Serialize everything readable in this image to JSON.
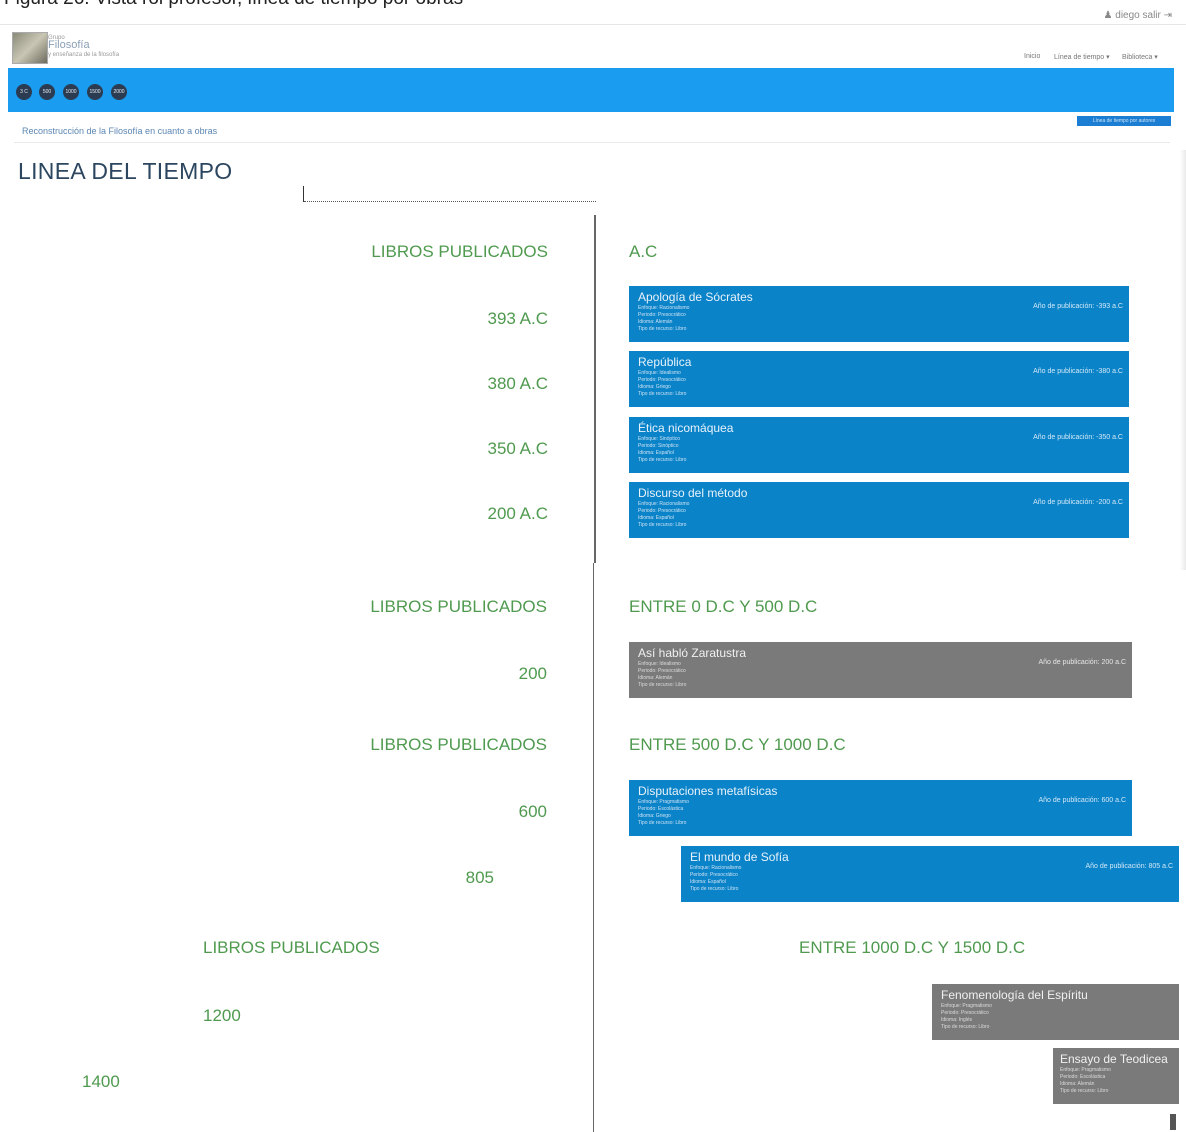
{
  "caption": "Figura 26: Vista rol profesor, línea de tiempo por obras",
  "user": {
    "label": "♟ diego  salir ⇥"
  },
  "brand": {
    "small": "Grupo",
    "name": "Filosofía",
    "sub": "y enseñanza de la filosofía"
  },
  "nav": {
    "inicio": "Inicio",
    "linea": "Línea de tiempo ▾",
    "biblioteca": "Biblioteca ▾"
  },
  "eras": [
    "3 C",
    "500",
    "1000",
    "1500",
    "2000"
  ],
  "breadcrumb": "Reconstrucción de la Filosofía en cuanto a obras",
  "top_button": "Línea de tiempo por autores",
  "page_title": "LINEA DEL TIEMPO",
  "sections": [
    {
      "left_label": "LIBROS PUBLICADOS",
      "right_label": "A.C",
      "years": [
        "393 A.C",
        "380 A.C",
        "350 A.C",
        "200 A.C"
      ],
      "cards": [
        {
          "title": "Apología de Sócrates",
          "meta": [
            "Enfoque: Racionalismo",
            "Periodo: Presocrático",
            "Idioma: Alemán",
            "Tipo de recurso: Libro"
          ],
          "year": "Año de publicación: -393 a.C"
        },
        {
          "title": "República",
          "meta": [
            "Enfoque: Idealismo",
            "Periodo: Presocrático",
            "Idioma: Griego",
            "Tipo de recurso: Libro"
          ],
          "year": "Año de publicación: -380 a.C"
        },
        {
          "title": "Ética nicomáquea",
          "meta": [
            "Enfoque: Sinóptico",
            "Periodo: Sinóptico",
            "Idioma: Español",
            "Tipo de recurso: Libro"
          ],
          "year": "Año de publicación: -350 a.C"
        },
        {
          "title": "Discurso del método",
          "meta": [
            "Enfoque: Racionalismo",
            "Periodo: Presocrático",
            "Idioma: Español",
            "Tipo de recurso: Libro"
          ],
          "year": "Año de publicación: -200 a.C"
        }
      ]
    },
    {
      "left_label": "LIBROS PUBLICADOS",
      "right_label": "ENTRE 0 D.C Y 500 D.C",
      "years": [
        "200"
      ],
      "cards": [
        {
          "title": "Así habló Zaratustra",
          "meta": [
            "Enfoque: Idealismo",
            "Periodo: Presocrático",
            "Idioma: Alemán",
            "Tipo de recurso: Libro"
          ],
          "year": "Año de publicación: 200 a.C"
        }
      ]
    },
    {
      "left_label": "LIBROS PUBLICADOS",
      "right_label": "ENTRE 500 D.C Y 1000 D.C",
      "years": [
        "600",
        "805"
      ],
      "cards": [
        {
          "title": "Disputaciones metafísicas",
          "meta": [
            "Enfoque: Pragmatismo",
            "Periodo: Escolástica",
            "Idioma: Griego",
            "Tipo de recurso: Libro"
          ],
          "year": "Año de publicación: 600 a.C"
        },
        {
          "title": "El mundo de Sofía",
          "meta": [
            "Enfoque: Racionalismo",
            "Periodo: Presocrático",
            "Idioma: Español",
            "Tipo de recurso: Libro"
          ],
          "year": "Año de publicación: 805 a.C"
        }
      ]
    },
    {
      "left_label": "LIBROS PUBLICADOS",
      "right_label": "ENTRE 1000 D.C Y 1500 D.C",
      "years": [
        "1200",
        "1400"
      ],
      "cards": [
        {
          "title": "Fenomenología del Espíritu",
          "meta": [
            "Enfoque: Pragmatismo",
            "Periodo: Presocrático",
            "Idioma: Inglés",
            "Tipo de recurso: Libro"
          ],
          "year": ""
        },
        {
          "title": "Ensayo de Teodicea",
          "meta": [
            "Enfoque: Pragmatismo",
            "Periodo: Escolástica",
            "Idioma: Alemán",
            "Tipo de recurso: Libro"
          ],
          "year": ""
        }
      ]
    }
  ]
}
